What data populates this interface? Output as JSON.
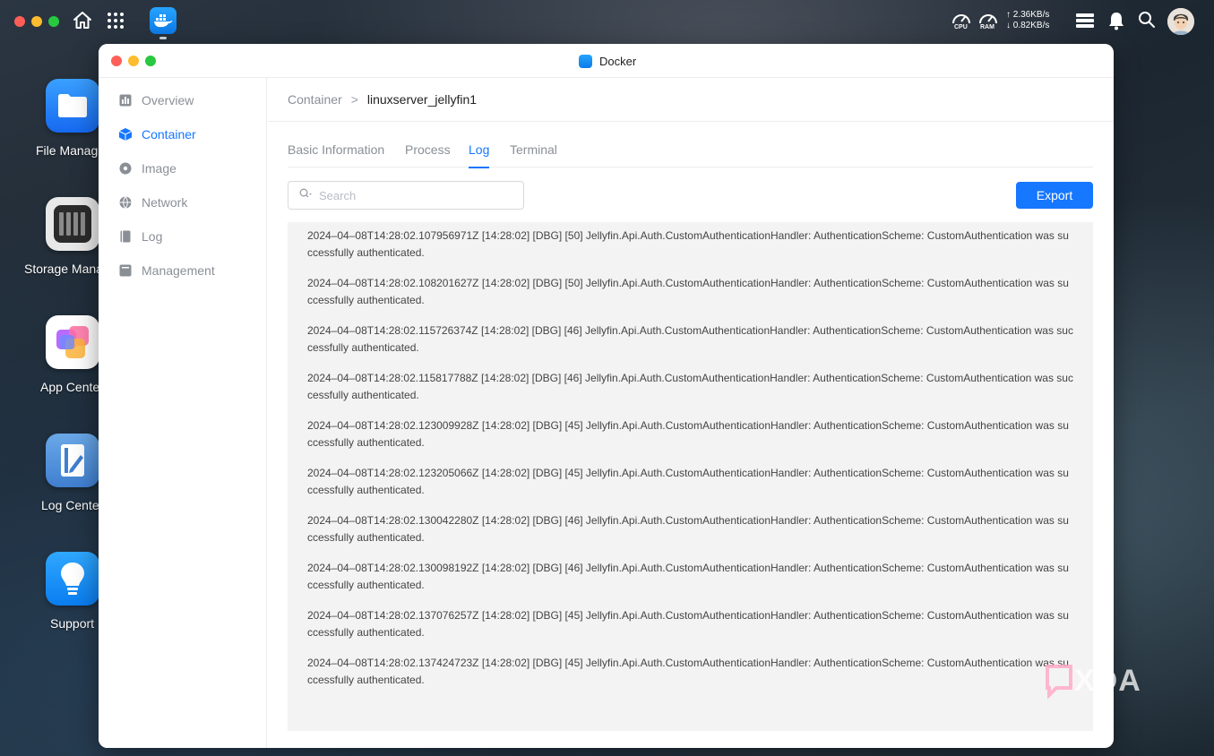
{
  "topbar": {
    "cpu_label": "CPU",
    "ram_label": "RAM",
    "upload_rate": "↑ 2.36KB/s",
    "download_rate": "↓ 0.82KB/s"
  },
  "desktop": {
    "items": [
      {
        "label": "File Manag"
      },
      {
        "label": "Storage Mana"
      },
      {
        "label": "App Cente"
      },
      {
        "label": "Log Cente"
      },
      {
        "label": "Support"
      }
    ]
  },
  "window": {
    "title": "Docker"
  },
  "sidebar": {
    "items": [
      {
        "label": "Overview"
      },
      {
        "label": "Container"
      },
      {
        "label": "Image"
      },
      {
        "label": "Network"
      },
      {
        "label": "Log"
      },
      {
        "label": "Management"
      }
    ],
    "active_index": 1
  },
  "breadcrumb": {
    "parent": "Container",
    "separator": ">",
    "current": "linuxserver_jellyfin1"
  },
  "tabs": {
    "items": [
      {
        "label": "Basic Information"
      },
      {
        "label": "Process"
      },
      {
        "label": "Log"
      },
      {
        "label": "Terminal"
      }
    ],
    "active_index": 2
  },
  "search": {
    "placeholder": "Search",
    "value": ""
  },
  "export_label": "Export",
  "logs": [
    "2024–04–08T14:28:02.107956971Z [14:28:02] [DBG] [50] Jellyfin.Api.Auth.CustomAuthenticationHandler: AuthenticationScheme: CustomAuthentication was successfully authenticated.",
    "2024–04–08T14:28:02.108201627Z [14:28:02] [DBG] [50] Jellyfin.Api.Auth.CustomAuthenticationHandler: AuthenticationScheme: CustomAuthentication was successfully authenticated.",
    "2024–04–08T14:28:02.115726374Z [14:28:02] [DBG] [46] Jellyfin.Api.Auth.CustomAuthenticationHandler: AuthenticationScheme: CustomAuthentication was successfully authenticated.",
    "2024–04–08T14:28:02.115817788Z [14:28:02] [DBG] [46] Jellyfin.Api.Auth.CustomAuthenticationHandler: AuthenticationScheme: CustomAuthentication was successfully authenticated.",
    "2024–04–08T14:28:02.123009928Z [14:28:02] [DBG] [45] Jellyfin.Api.Auth.CustomAuthenticationHandler: AuthenticationScheme: CustomAuthentication was successfully authenticated.",
    "2024–04–08T14:28:02.123205066Z [14:28:02] [DBG] [45] Jellyfin.Api.Auth.CustomAuthenticationHandler: AuthenticationScheme: CustomAuthentication was successfully authenticated.",
    "2024–04–08T14:28:02.130042280Z [14:28:02] [DBG] [46] Jellyfin.Api.Auth.CustomAuthenticationHandler: AuthenticationScheme: CustomAuthentication was successfully authenticated.",
    "2024–04–08T14:28:02.130098192Z [14:28:02] [DBG] [46] Jellyfin.Api.Auth.CustomAuthenticationHandler: AuthenticationScheme: CustomAuthentication was successfully authenticated.",
    "2024–04–08T14:28:02.137076257Z [14:28:02] [DBG] [45] Jellyfin.Api.Auth.CustomAuthenticationHandler: AuthenticationScheme: CustomAuthentication was successfully authenticated.",
    "2024–04–08T14:28:02.137424723Z [14:28:02] [DBG] [45] Jellyfin.Api.Auth.CustomAuthenticationHandler: AuthenticationScheme: CustomAuthentication was successfully authenticated."
  ],
  "watermark": "XDA",
  "colors": {
    "accent": "#1677ff",
    "log_background": "#f3f3f3"
  }
}
